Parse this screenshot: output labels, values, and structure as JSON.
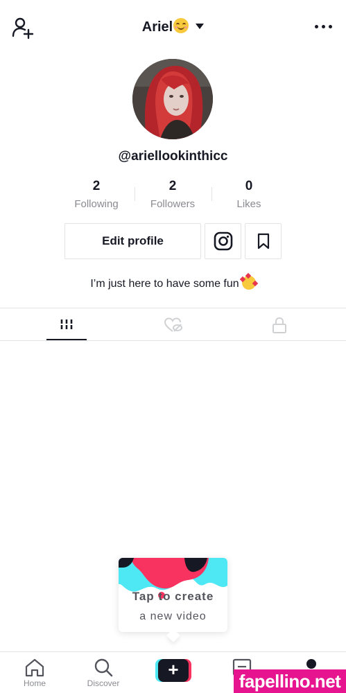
{
  "header": {
    "title": "Ariel",
    "icons": {
      "add_user": "add-user-icon",
      "dropdown": "caret-down-icon",
      "more": "more-icon"
    }
  },
  "profile": {
    "handle": "@ariellookinthicc",
    "stats": [
      {
        "value": "2",
        "label": "Following"
      },
      {
        "value": "2",
        "label": "Followers"
      },
      {
        "value": "0",
        "label": "Likes"
      }
    ],
    "edit_button": "Edit profile",
    "bio": "I’m just here to have some fun"
  },
  "tabs": [
    {
      "icon": "videos-grid-icon",
      "active": true
    },
    {
      "icon": "liked-hidden-icon",
      "active": false
    },
    {
      "icon": "private-lock-icon",
      "active": false
    }
  ],
  "cta": {
    "line1": "Tap to create",
    "line2": "a new video"
  },
  "nav": {
    "home": "Home",
    "discover": "Discover",
    "create": "+",
    "inbox": "I",
    "me": ""
  },
  "watermark": "fapellino.net",
  "colors": {
    "text": "#161823",
    "muted": "#8a8b91",
    "border": "#e3e3e4",
    "cyan": "#4de8f4",
    "pink": "#f9335f"
  }
}
